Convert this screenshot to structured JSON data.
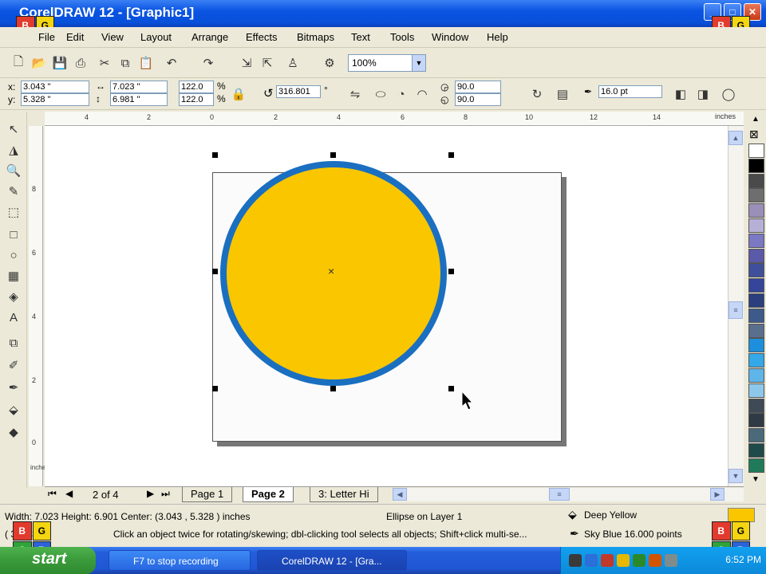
{
  "window": {
    "title": "CorelDRAW 12 - [Graphic1]"
  },
  "menu": [
    "File",
    "Edit",
    "View",
    "Layout",
    "Arrange",
    "Effects",
    "Bitmaps",
    "Text",
    "Tools",
    "Window",
    "Help"
  ],
  "toolbar": {
    "zoom": "100%"
  },
  "property_bar": {
    "x_label": "x:",
    "x_value": "3.043 \"",
    "y_label": "y:",
    "y_value": "5.328 \"",
    "width_value": "7.023 \"",
    "height_value": "6.981 \"",
    "scale_x": "122.0",
    "scale_y": "122.0",
    "percent": "%",
    "rotation": "316.801",
    "degree": "°",
    "start_angle": "90.0",
    "end_angle": "90.0",
    "outline_width": "16.0 pt"
  },
  "ruler": {
    "h_ticks": [
      "4",
      "2",
      "0",
      "2",
      "4",
      "6",
      "8",
      "10",
      "12",
      "14"
    ],
    "unit": "inches",
    "v_ticks": [
      "8",
      "6",
      "4",
      "2",
      "0"
    ],
    "v_unit": "inches"
  },
  "palette_colors": [
    "#ffffff",
    "#000000",
    "#4a4a4a",
    "#6e6e6e",
    "#9a8fb8",
    "#b7b0d6",
    "#7b78c4",
    "#5a5aa8",
    "#3f4f9a",
    "#34459a",
    "#2a3f7c",
    "#3d5a8a",
    "#5a6e8e",
    "#1e8fdc",
    "#35a8e8",
    "#5fb4e8",
    "#8dc8ea",
    "#3f4a56",
    "#2f3a44",
    "#4a6a7a",
    "#1f4a4a",
    "#1f7a5a"
  ],
  "page_tabs": {
    "count": "2 of 4",
    "tabs": [
      "Page 1",
      "Page 2",
      "3: Letter Hi"
    ]
  },
  "status": {
    "dims": "Width: 7.023  Height: 6.901  Center: (3.043 , 5.328 )  inches",
    "object": "Ellipse on Layer 1",
    "fill_name": "Deep Yellow",
    "fill_color": "#f9c600",
    "coords": "( 3.  ,  837 )",
    "hint": "Click an object twice for rotating/skewing; dbl-clicking tool selects all objects; Shift+click multi-se...",
    "outline_name": "Sky Blue  16.000 points",
    "outline_color": "#1a6fc0"
  },
  "taskbar": {
    "start": "start",
    "items": [
      "F7 to stop recording",
      "CorelDRAW 12 - [Gra..."
    ],
    "clock": "6:52 PM"
  },
  "overlay_labels": {
    "b": "B",
    "g": "G",
    "s": "S",
    "r": "R"
  }
}
